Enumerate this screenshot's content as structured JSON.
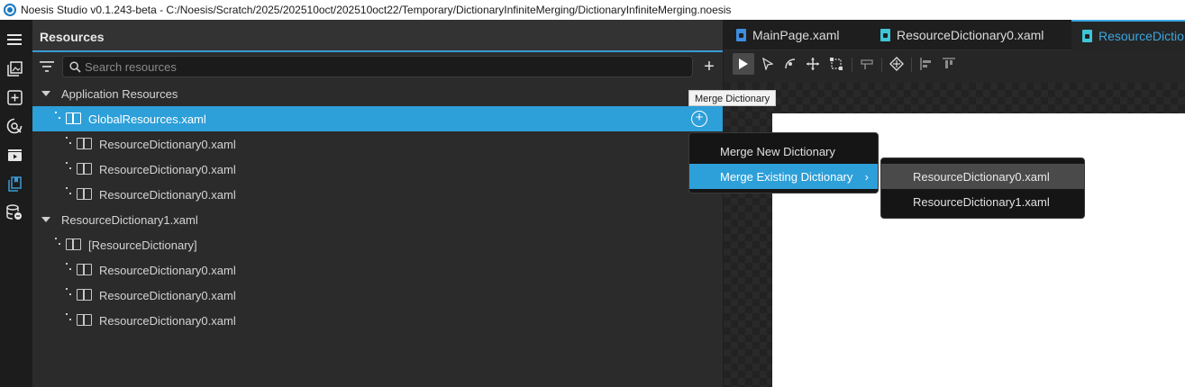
{
  "window": {
    "title": "Noesis Studio v0.1.243-beta - C:/Noesis/Scratch/2025/202510oct/202510oct22/Temporary/DictionaryInfiniteMerging/DictionaryInfiniteMerging.noesis"
  },
  "activity_bar": {
    "icons": [
      "hamburger-menu-icon",
      "assets-icon",
      "add-item-icon",
      "palette-icon",
      "animation-icon",
      "resources-icon",
      "data-sources-icon"
    ]
  },
  "resources_panel": {
    "title": "Resources",
    "search_placeholder": "Search resources",
    "add_label": "+",
    "tree": [
      {
        "label": "Application Resources",
        "kind": "group"
      },
      {
        "label": "GlobalResources.xaml",
        "kind": "dictionary",
        "selected": true
      },
      {
        "label": "ResourceDictionary0.xaml",
        "kind": "merged"
      },
      {
        "label": "ResourceDictionary0.xaml",
        "kind": "merged"
      },
      {
        "label": "ResourceDictionary0.xaml",
        "kind": "merged"
      },
      {
        "label": "ResourceDictionary1.xaml",
        "kind": "group"
      },
      {
        "label": "[ResourceDictionary]",
        "kind": "dictionary"
      },
      {
        "label": "ResourceDictionary0.xaml",
        "kind": "merged"
      },
      {
        "label": "ResourceDictionary0.xaml",
        "kind": "merged"
      },
      {
        "label": "ResourceDictionary0.xaml",
        "kind": "merged"
      }
    ]
  },
  "tooltip": {
    "text": "Merge Dictionary"
  },
  "context_menu": {
    "items": [
      {
        "label": "Merge New Dictionary"
      },
      {
        "label": "Merge Existing Dictionary",
        "highlighted": true,
        "chevron": "›"
      }
    ]
  },
  "submenu": {
    "items": [
      {
        "label": "ResourceDictionary0.xaml",
        "highlighted": true
      },
      {
        "label": "ResourceDictionary1.xaml"
      }
    ]
  },
  "editor": {
    "tabs": [
      {
        "label": "MainPage.xaml"
      },
      {
        "label": "ResourceDictionary0.xaml"
      },
      {
        "label": "ResourceDictio",
        "active": true
      }
    ],
    "toolbar_icons": [
      "select-icon",
      "direct-select-icon",
      "pen-icon",
      "move-icon",
      "transform-icon",
      "paint-bucket-icon",
      "snap-icon",
      "align-left-icon",
      "align-top-icon"
    ]
  },
  "colors": {
    "accent": "#2d9fd9",
    "panel": "#2b2b2b",
    "artboard": "#ffffff"
  }
}
